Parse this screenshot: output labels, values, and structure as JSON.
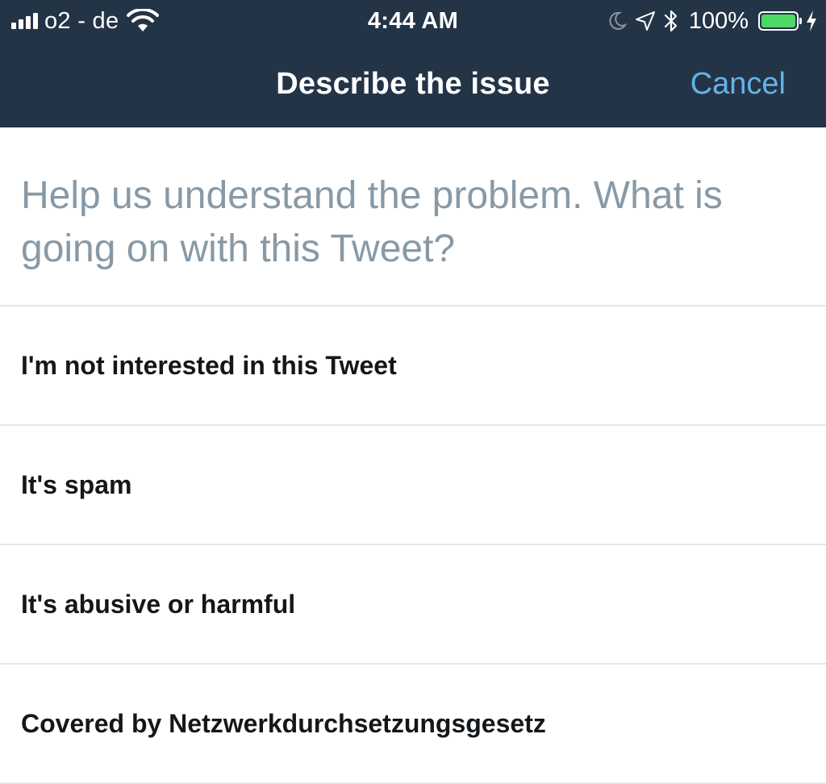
{
  "status_bar": {
    "carrier": "o2 - de",
    "time": "4:44 AM",
    "battery_percent": "100%",
    "battery_level": 1.0,
    "battery_color": "#4cd964",
    "icons": [
      "signal-icon",
      "wifi-icon",
      "moon-icon",
      "location-arrow-icon",
      "bluetooth-icon",
      "battery-icon",
      "charging-bolt-icon"
    ]
  },
  "nav": {
    "title": "Describe the issue",
    "cancel_label": "Cancel",
    "background_color": "#243447",
    "cancel_color": "#66b3e8"
  },
  "prompt": "Help us understand the problem. What is going on with this Tweet?",
  "options": [
    {
      "label": "I'm not interested in this Tweet"
    },
    {
      "label": "It's spam"
    },
    {
      "label": "It's abusive or harmful"
    },
    {
      "label": "Covered by Netzwerkdurchsetzungsgesetz"
    }
  ]
}
